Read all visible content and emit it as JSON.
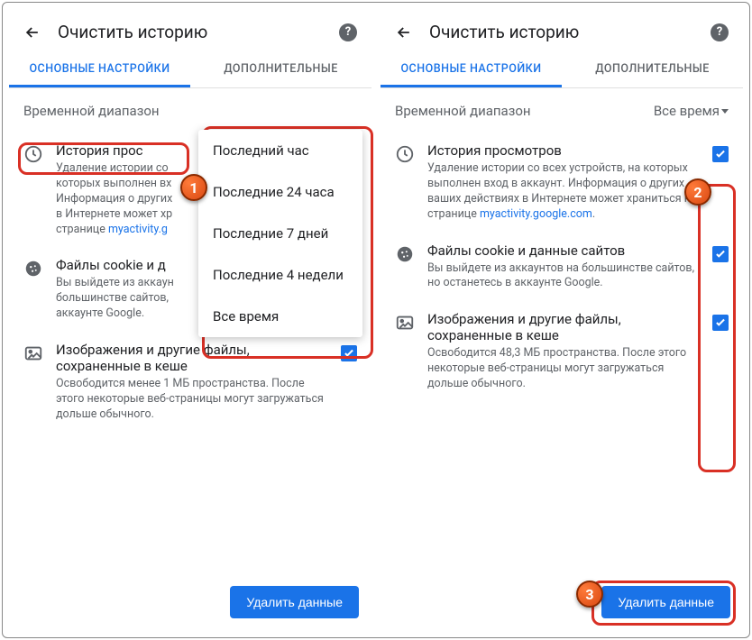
{
  "header": {
    "title": "Очистить историю"
  },
  "tabs": {
    "basic": "ОСНОВНЫЕ НАСТРОЙКИ",
    "advanced": "ДОПОЛНИТЕЛЬНЫЕ"
  },
  "time_range": {
    "label": "Временной диапазон",
    "value": "Все время",
    "options": [
      "Последний час",
      "Последние 24 часа",
      "Последние 7 дней",
      "Последние 4 недели",
      "Все время"
    ]
  },
  "items_left": {
    "history": {
      "title": "История прос",
      "desc1": "Удаление истории со",
      "desc2": "которых выполнен вх",
      "desc3": "Информация о других",
      "desc4": "в Интернете может хр",
      "desc5": "странице ",
      "link": "myactivity.g"
    },
    "cookies": {
      "title": "Файлы cookie и д",
      "desc1": "Вы выйдете из аккаун",
      "desc2": "большинстве сайтов,",
      "desc3": "аккаунте Google."
    },
    "cache": {
      "title": "Изображения и другие файлы, сохраненные в кеше",
      "desc": "Освободится менее 1 МБ пространства. После этого некоторые веб-страницы могут загружаться дольше обычного."
    }
  },
  "items_right": {
    "history": {
      "title": "История просмотров",
      "desc_pre": "Удаление истории со всех устройств, на которых выполнен вход в аккаунт. Информация о других ваших действиях в Интернете может храниться на странице ",
      "link": "myactivity.google.com",
      "desc_post": "."
    },
    "cookies": {
      "title": "Файлы cookie и данные сайтов",
      "desc": "Вы выйдете из аккаунтов на большинстве сайтов, но останетесь в аккаунте Google."
    },
    "cache": {
      "title": "Изображения и другие файлы, сохраненные в кеше",
      "desc": "Освободится 48,3 МБ пространства. После этого некоторые веб-страницы могут загружаться дольше обычного."
    }
  },
  "delete_button": "Удалить данные",
  "steps": {
    "s1": "1",
    "s2": "2",
    "s3": "3"
  }
}
